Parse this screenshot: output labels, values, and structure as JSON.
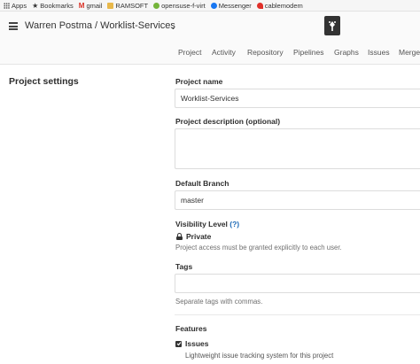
{
  "bookmarks": [
    {
      "icon": "apps-grid-icon",
      "label": "Apps"
    },
    {
      "icon": "star-icon",
      "label": "Bookmarks"
    },
    {
      "icon": "gmail-icon",
      "label": "gmail"
    },
    {
      "icon": "folder-icon",
      "label": "RAMSOFT"
    },
    {
      "icon": "opensuse-icon",
      "label": "opensuse-f-virt"
    },
    {
      "icon": "messenger-icon",
      "label": "Messenger"
    },
    {
      "icon": "huawei-icon",
      "label": "cablemodem"
    }
  ],
  "header": {
    "title": "Warren Postma / Worklist-Services",
    "caret": "⌄"
  },
  "nav": {
    "tabs": [
      "Project",
      "Activity",
      "Repository",
      "Pipelines",
      "Graphs",
      "Issues",
      "Merge"
    ]
  },
  "settings": {
    "heading": "Project settings",
    "project_name_label": "Project name",
    "project_name_value": "Worklist-Services",
    "description_label": "Project description (optional)",
    "description_value": "",
    "default_branch_label": "Default Branch",
    "default_branch_value": "master",
    "visibility_label": "Visibility Level",
    "visibility_help_link": "(?)",
    "visibility_value": "Private",
    "visibility_help": "Project access must be granted explicitly to each user.",
    "tags_label": "Tags",
    "tags_value": "",
    "tags_help": "Separate tags with commas.",
    "features_label": "Features",
    "issues_label": "Issues",
    "issues_checked": true,
    "issues_help": "Lightweight issue tracking system for this project"
  },
  "colors": {
    "link": "#1b69b6",
    "header_bg": "#fafafa"
  }
}
